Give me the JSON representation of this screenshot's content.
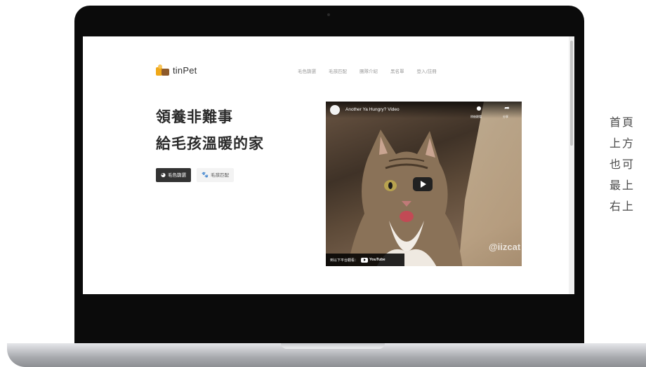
{
  "site": {
    "logo_text": "tinPet",
    "nav": [
      "毛色篩選",
      "毛孩匹配",
      "團隊介紹",
      "黑名單",
      "登入/註冊"
    ]
  },
  "hero": {
    "title_line1": "領養非難事",
    "title_line2": "給毛孩溫暖的家",
    "btn_filter_label": "毛色篩選",
    "btn_match_label": "毛孩匹配"
  },
  "video": {
    "title": "Another Ya Hungry? Video",
    "watch_later_label": "稍後觀看",
    "share_label": "分享",
    "watermark": "@iizcat",
    "watch_on_label": "到以下平台觀看：",
    "youtube_label": "YouTube"
  },
  "side_caption": [
    "首頁",
    "上方",
    "也可",
    "最上",
    "右上"
  ]
}
